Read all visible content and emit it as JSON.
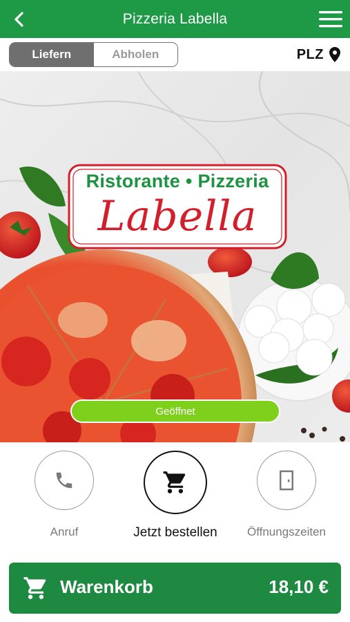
{
  "header": {
    "title": "Pizzeria Labella",
    "back_icon": "chevron-left-icon",
    "menu_icon": "hamburger-menu-icon",
    "background": "#1e9a47"
  },
  "delivery_toggle": {
    "options": [
      "Liefern",
      "Abholen"
    ],
    "selected": "Liefern"
  },
  "postcode": {
    "label": "PLZ",
    "icon": "location-pin-icon"
  },
  "hero": {
    "logo_line_1": "Ristorante • Pizzeria",
    "logo_line_2": "Labella",
    "status": "Geöffnet",
    "status_color": "#7fcf1d"
  },
  "actions": [
    {
      "label": "Anruf",
      "icon": "phone-icon"
    },
    {
      "label": "Jetzt bestellen",
      "icon": "shopping-cart-icon"
    },
    {
      "label": "Öffnungszeiten",
      "icon": "door-icon"
    }
  ],
  "cart": {
    "label": "Warenkorb",
    "total": "18,10 €",
    "icon": "shopping-cart-icon",
    "background": "#1e8a41"
  }
}
